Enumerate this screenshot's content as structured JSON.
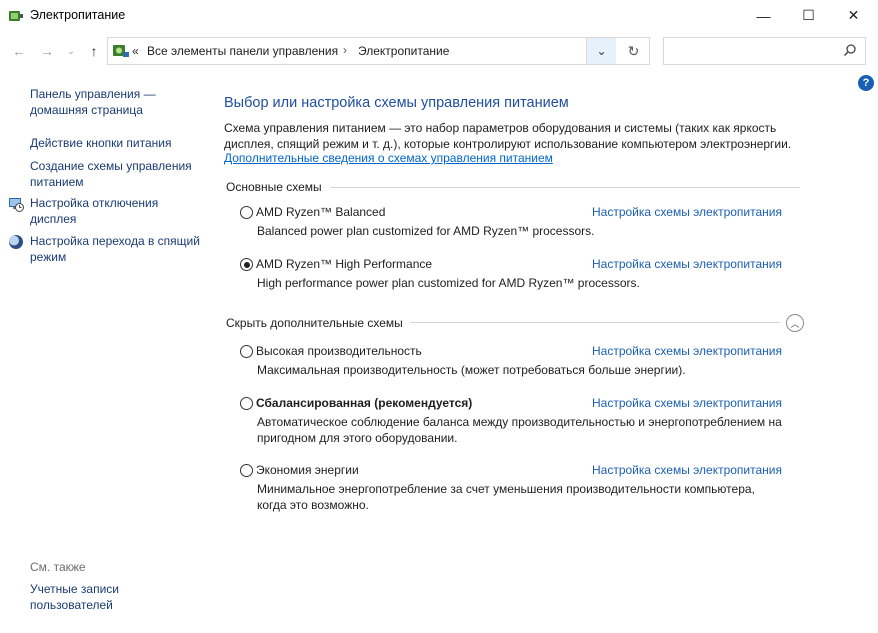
{
  "window": {
    "title": "Электропитание",
    "controls": {
      "minimize": "—",
      "maximize": "☐",
      "close": "✕"
    }
  },
  "nav": {
    "back_glyph": "←",
    "forward_glyph": "→",
    "recent_glyph": "⌄",
    "up_glyph": "↑",
    "overflow": "«",
    "breadcrumbs": [
      "Все элементы панели управления",
      "Электропитание"
    ],
    "separator": "›",
    "dropdown_glyph": "⌄",
    "refresh_glyph": "↻",
    "search_placeholder": ""
  },
  "help_glyph": "?",
  "sidebar": {
    "items": [
      {
        "label": "Панель управления — домашняя страница",
        "icon": ""
      },
      {
        "label": "Действие кнопки питания",
        "icon": ""
      },
      {
        "label": "Создание схемы управления питанием",
        "icon": ""
      },
      {
        "label": "Настройка отключения дисплея",
        "icon": "display-clock-icon"
      },
      {
        "label": "Настройка перехода в спящий режим",
        "icon": "sleep-moon-icon"
      }
    ],
    "see_also": "См. также",
    "see_also_items": [
      {
        "label": "Учетные записи пользователей"
      }
    ]
  },
  "main": {
    "title": "Выбор или настройка схемы управления питанием",
    "description": "Схема управления питанием — это набор параметров оборудования и системы (таких как яркость дисплея, спящий режим и т. д.), которые контролируют использование компьютером электроэнергии.",
    "more_link": "Дополнительные сведения о схемах управления питанием",
    "sections": [
      {
        "heading": "Основные схемы",
        "plans": [
          {
            "name": "AMD Ryzen™ Balanced",
            "selected": false,
            "bold": false,
            "link": "Настройка схемы электропитания",
            "description": "Balanced power plan customized for AMD Ryzen™ processors."
          },
          {
            "name": "AMD Ryzen™ High Performance",
            "selected": true,
            "bold": false,
            "link": "Настройка схемы электропитания",
            "description": "High performance power plan customized for AMD Ryzen™ processors."
          }
        ]
      },
      {
        "heading": "Скрыть дополнительные схемы",
        "collapse_glyph": "︿",
        "plans": [
          {
            "name": "Высокая производительность",
            "selected": false,
            "bold": false,
            "link": "Настройка схемы электропитания",
            "description": "Максимальная производительность (может потребоваться больше энергии)."
          },
          {
            "name": "Сбалансированная (рекомендуется)",
            "selected": false,
            "bold": true,
            "link": "Настройка схемы электропитания",
            "description": "Автоматическое соблюдение баланса между производительностью и энергопотреблением на пригодном для этого оборудовании."
          },
          {
            "name": "Экономия энергии",
            "selected": false,
            "bold": false,
            "link": "Настройка схемы электропитания",
            "description": "Минимальное энергопотребление за счет уменьшения производительности компьютера, когда это возможно."
          }
        ]
      }
    ]
  }
}
